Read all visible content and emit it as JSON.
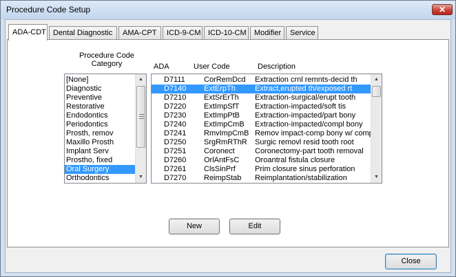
{
  "window": {
    "title": "Procedure Code Setup",
    "close_glyph": "✕"
  },
  "tabs": [
    {
      "label": "ADA-CDT",
      "active": true
    },
    {
      "label": "Dental Diagnostic"
    },
    {
      "label": "AMA-CPT"
    },
    {
      "label": "ICD-9-CM"
    },
    {
      "label": "ICD-10-CM"
    },
    {
      "label": "Modifier"
    },
    {
      "label": "Service"
    }
  ],
  "category": {
    "label_line1": "Procedure Code",
    "label_line2": "Category",
    "items": [
      "[None]",
      "Diagnostic",
      "Preventive",
      "Restorative",
      "Endodontics",
      "Periodontics",
      "Prosth, remov",
      "Maxillo Prosth",
      "Implant Serv",
      "Prostho, fixed",
      "Oral Surgery",
      "Orthodontics"
    ],
    "selected": "Oral Surgery"
  },
  "codes": {
    "headers": {
      "ada": "ADA",
      "user_code": "User Code",
      "description": "Description"
    },
    "rows": [
      {
        "ada": "D7111",
        "user": "CorRemDcd",
        "desc": "Extraction crnl remnts-decid th"
      },
      {
        "ada": "D7140",
        "user": "ExtErpTh",
        "desc": "Extract,erupted th/exposed rt"
      },
      {
        "ada": "D7210",
        "user": "ExtSrErTh",
        "desc": "Extraction-surgical/erupt tooth"
      },
      {
        "ada": "D7220",
        "user": "ExtImpSfT",
        "desc": "Extraction-impacted/soft tis"
      },
      {
        "ada": "D7230",
        "user": "ExtImpPtB",
        "desc": "Extraction-impacted/part bony"
      },
      {
        "ada": "D7240",
        "user": "ExtImpCmB",
        "desc": "Extraction-impacted/compl bony"
      },
      {
        "ada": "D7241",
        "user": "RmvImpCmB",
        "desc": "Remov impact-comp bony w/ comp"
      },
      {
        "ada": "D7250",
        "user": "SrgRmRThR",
        "desc": "Surgic removl resid tooth root"
      },
      {
        "ada": "D7251",
        "user": "Coronect",
        "desc": "Coronectomy-part tooth removal"
      },
      {
        "ada": "D7260",
        "user": "OrlAntFsC",
        "desc": "Oroantral fistula closure"
      },
      {
        "ada": "D7261",
        "user": "ClsSinPrf",
        "desc": "Prim closure sinus perforation"
      },
      {
        "ada": "D7270",
        "user": "ReimpStab",
        "desc": "Reimplantation/stabilization"
      }
    ],
    "selected_index": 1
  },
  "buttons": {
    "new": "New",
    "edit": "Edit",
    "close": "Close"
  }
}
